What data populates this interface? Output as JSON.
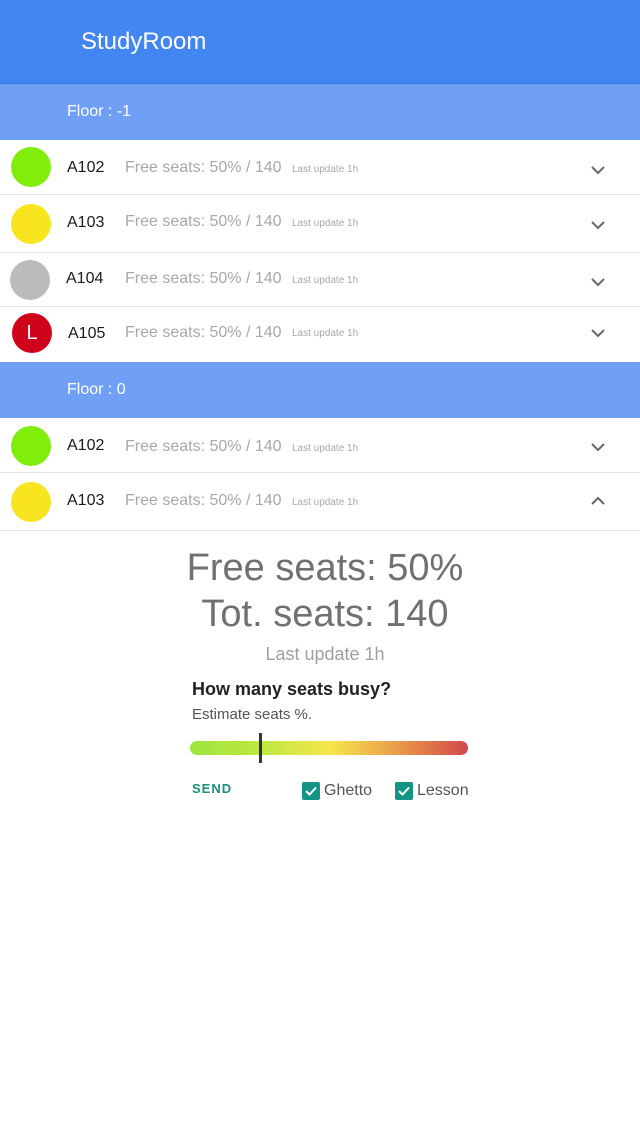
{
  "app": {
    "title": "StudyRoom"
  },
  "floors": [
    {
      "label": "Floor :  -1",
      "rooms": [
        {
          "name": "A102",
          "status_color": "#80ee0a",
          "badge": "",
          "free": "Free seats: 50% / 140",
          "updated": "Last update 1h",
          "chevron": "chevron-down-icon"
        },
        {
          "name": "A103",
          "status_color": "#f8e520",
          "badge": "",
          "free": "Free seats: 50% / 140",
          "updated": "Last update 1h",
          "chevron": "chevron-down-icon"
        },
        {
          "name": "A104",
          "status_color": "#bbbbbb",
          "badge": "",
          "free": "Free seats: 50% / 140",
          "updated": "Last update 1h",
          "chevron": "chevron-down-icon"
        },
        {
          "name": "A105",
          "status_color": "#d0021b",
          "badge": "L",
          "free": "Free seats: 50% / 140",
          "updated": "Last update 1h",
          "chevron": "chevron-down-icon"
        }
      ]
    },
    {
      "label": "Floor :  0",
      "rooms": [
        {
          "name": "A102",
          "status_color": "#80ee0a",
          "badge": "",
          "free": "Free seats: 50% / 140",
          "updated": "Last update 1h",
          "chevron": "chevron-down-icon"
        },
        {
          "name": "A103",
          "status_color": "#f8e520",
          "badge": "",
          "free": "Free seats: 50% / 140",
          "updated": "Last update 1h",
          "chevron": "chevron-up-icon"
        }
      ]
    }
  ],
  "detail": {
    "free_seats": "Free seats: 50%",
    "total_seats": "Tot. seats:  140",
    "last_update": "Last update 1h",
    "question": "How many seats busy?",
    "hint": "Estimate seats %.",
    "slider_value": 0.25,
    "send_label": "SEND",
    "checkboxes": [
      {
        "label": "Ghetto",
        "checked": true
      },
      {
        "label": "Lesson",
        "checked": true
      }
    ]
  },
  "colors": {
    "appbar": "#4286f4",
    "floor_header": "#6fa0f6",
    "accent": "#139484"
  }
}
